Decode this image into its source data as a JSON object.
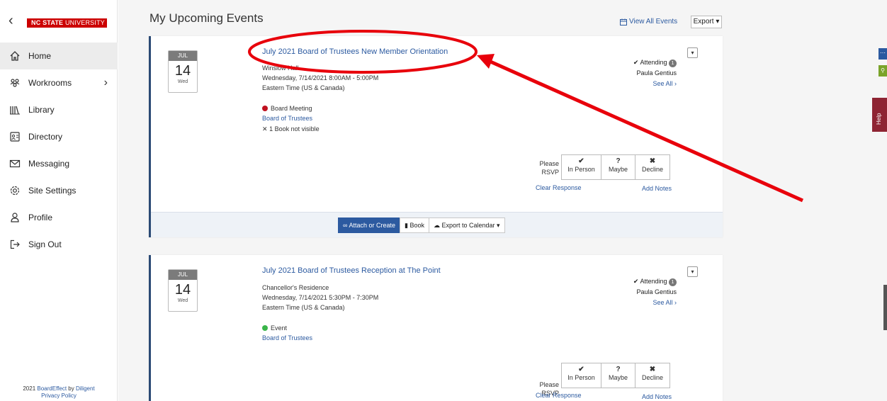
{
  "sidebar": {
    "logo_bold": "NC STATE",
    "logo_light": "UNIVERSITY",
    "items": [
      {
        "label": "Home"
      },
      {
        "label": "Workrooms"
      },
      {
        "label": "Library"
      },
      {
        "label": "Directory"
      },
      {
        "label": "Messaging"
      },
      {
        "label": "Site Settings"
      },
      {
        "label": "Profile"
      },
      {
        "label": "Sign Out"
      }
    ],
    "footer_prefix": "2021 ",
    "footer_brand": "BoardEffect",
    "footer_by": " by ",
    "footer_company": "Diligent",
    "footer_privacy": "Privacy Policy"
  },
  "main": {
    "title": "My Upcoming Events",
    "view_all": "View All Events",
    "export": "Export ▾"
  },
  "events": [
    {
      "month": "JUL",
      "day": "14",
      "dow": "Wed",
      "title": "July 2021 Board of Trustees New Member Orientation",
      "location": "Winslow Hall",
      "datetime": "Wednesday, 7/14/2021 8:00AM - 5:00PM",
      "timezone": "Eastern Time (US & Canada)",
      "category": "Board Meeting",
      "category_color": "#c0111f",
      "group": "Board of Trustees",
      "note": "1 Book not visible",
      "attending_label": "Attending",
      "attending_count": "1",
      "attendee": "Paula Gentius",
      "see_all": "See All ›",
      "rsvp_label": "Please RSVP",
      "rsvp_in_person": "In Person",
      "rsvp_maybe": "Maybe",
      "rsvp_decline": "Decline",
      "clear_response": "Clear Response",
      "add_notes": "Add Notes",
      "attach": "Attach or Create",
      "book": "Book",
      "export_calendar": "Export to Calendar ▾"
    },
    {
      "month": "JUL",
      "day": "14",
      "dow": "Wed",
      "title": "July 2021 Board of Trustees Reception at The Point",
      "location": "Chancellor's Residence",
      "datetime": "Wednesday, 7/14/2021 5:30PM - 7:30PM",
      "timezone": "Eastern Time (US & Canada)",
      "category": "Event",
      "category_color": "#3ab54a",
      "group": "Board of Trustees",
      "attending_label": "Attending",
      "attending_count": "1",
      "attendee": "Paula Gentius",
      "see_all": "See All ›",
      "rsvp_label": "Please RSVP",
      "rsvp_in_person": "In Person",
      "rsvp_maybe": "Maybe",
      "rsvp_decline": "Decline",
      "clear_response": "Clear Response",
      "add_notes": "Add Notes"
    }
  ],
  "widgets": {
    "help": "Help"
  },
  "annotation": {
    "color": "#e8000b"
  }
}
